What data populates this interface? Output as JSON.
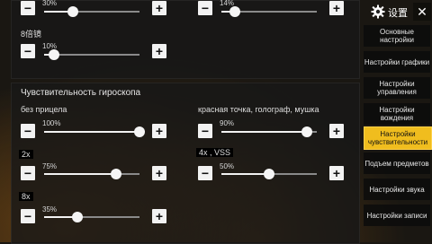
{
  "top_sliders": {
    "a": {
      "value_label": "30%",
      "level_percent": 30
    },
    "b": {
      "value_label": "14%",
      "level_percent": 14
    },
    "c": {
      "title": "8倍镜",
      "value_label": "10%",
      "level_percent": 10
    }
  },
  "gyro": {
    "section_title": "Чувствительность гироскопа",
    "sliders": [
      {
        "label": "без прицела",
        "value_label": "100%",
        "level_percent": 100
      },
      {
        "label": "красная точка, голограф, мушка",
        "value_label": "90%",
        "level_percent": 90
      },
      {
        "label": "2x",
        "value_label": "75%",
        "level_percent": 75
      },
      {
        "label": "4x , VSS",
        "value_label": "50%",
        "level_percent": 50
      },
      {
        "label": "8x",
        "value_label": "35%",
        "level_percent": 35
      }
    ]
  },
  "buttons": {
    "minus": "−",
    "plus": "+"
  },
  "header": {
    "title": "设置",
    "close": "✕"
  },
  "menu": [
    {
      "label": "Основные настройки",
      "active": false
    },
    {
      "label": "Настройки графики",
      "active": false
    },
    {
      "label": "Настройки управления",
      "active": false
    },
    {
      "label": "Настройки вождения",
      "active": false
    },
    {
      "label": "Настройки чувствительности",
      "active": true
    },
    {
      "label": "Подъем предметов",
      "active": false
    },
    {
      "label": "Настройки звука",
      "active": false
    },
    {
      "label": "Настройки записи",
      "active": false
    }
  ],
  "colors": {
    "accent": "#f0bd1e",
    "button": "#f2f2f2",
    "panel": "#181818"
  }
}
